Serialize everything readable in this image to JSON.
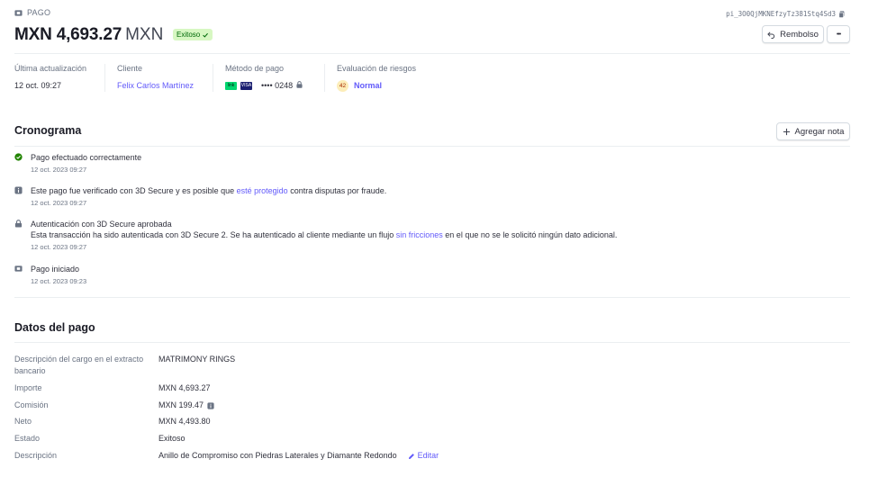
{
  "header": {
    "section_label": "PAGO",
    "payment_id": "pi_3O0QjMKNEfzyTz381Stq4Sd3",
    "amount": "MXN 4,693.27",
    "currency": "MXN",
    "status_badge": "Exitoso",
    "refund_label": "Rembolso",
    "more_label": "•••"
  },
  "summary": {
    "last_update_label": "Última actualización",
    "last_update_value": "12 oct. 09:27",
    "customer_label": "Cliente",
    "customer_value": "Felix Carlos Martínez",
    "payment_method_label": "Método de pago",
    "card_brand_1": "link",
    "card_brand_2": "VISA",
    "card_last4": "•••• 0248",
    "risk_label": "Evaluación de riesgos",
    "risk_score": "42",
    "risk_value": "Normal"
  },
  "timeline": {
    "title": "Cronograma",
    "add_note_label": "Agregar nota",
    "events": [
      {
        "icon": "check-circle-icon",
        "text": "Pago efectuado correctamente",
        "date": "12 oct. 2023 09:27"
      },
      {
        "icon": "info-icon",
        "text_pre": "Este pago fue verificado con 3D Secure y es posible que ",
        "text_link": "esté protegido",
        "text_post": " contra disputas por fraude.",
        "date": "12 oct. 2023 09:27"
      },
      {
        "icon": "lock-icon",
        "text": "Autenticación con 3D Secure aprobada",
        "sub_pre": "Esta transacción ha sido autenticada con 3D Secure 2. Se ha autenticado al cliente mediante un flujo ",
        "sub_link": "sin fricciones",
        "sub_post": " en el que no se le solicitó ningún dato adicional.",
        "date": "12 oct. 2023 09:27"
      },
      {
        "icon": "payment-icon",
        "text": "Pago iniciado",
        "date": "12 oct. 2023 09:23"
      }
    ]
  },
  "details": {
    "title": "Datos del pago",
    "rows": [
      {
        "label": "Descripción del cargo en el extracto bancario",
        "value": "MATRIMONY RINGS"
      },
      {
        "label": "Importe",
        "value": "MXN 4,693.27"
      },
      {
        "label": "Comisión",
        "value": "MXN 199.47"
      },
      {
        "label": "Neto",
        "value": "MXN 4,493.80"
      },
      {
        "label": "Estado",
        "value": "Exitoso"
      },
      {
        "label": "Descripción",
        "value": "Anillo de Compromiso con Piedras Laterales y Diamante Redondo"
      }
    ],
    "edit_label": "Editar"
  },
  "colors": {
    "accent": "#625afa",
    "success_bg": "#d7f7c2",
    "success_text": "#006908"
  }
}
